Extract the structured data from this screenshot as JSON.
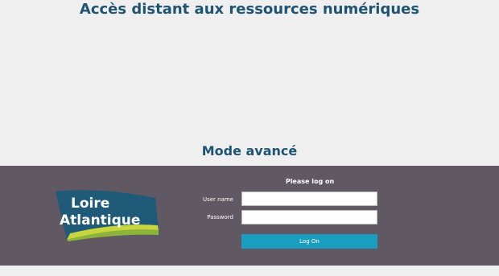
{
  "header": {
    "title": "Accès distant aux ressources numériques"
  },
  "mode": {
    "title": "Mode avancé"
  },
  "logo": {
    "line1": "Loire",
    "line2": "Atlantique",
    "colors": {
      "background": "#1f5a78",
      "stripe_light": "#c7d63c",
      "stripe_dark": "#8cb43a"
    }
  },
  "login": {
    "prompt": "Please log on",
    "username_label": "User name",
    "password_label": "Password",
    "username_value": "",
    "password_value": "",
    "button_label": "Log On"
  },
  "colors": {
    "background": "#efefef",
    "band": "#605862",
    "title_text": "#1e5472",
    "button": "#1a9ec0"
  }
}
